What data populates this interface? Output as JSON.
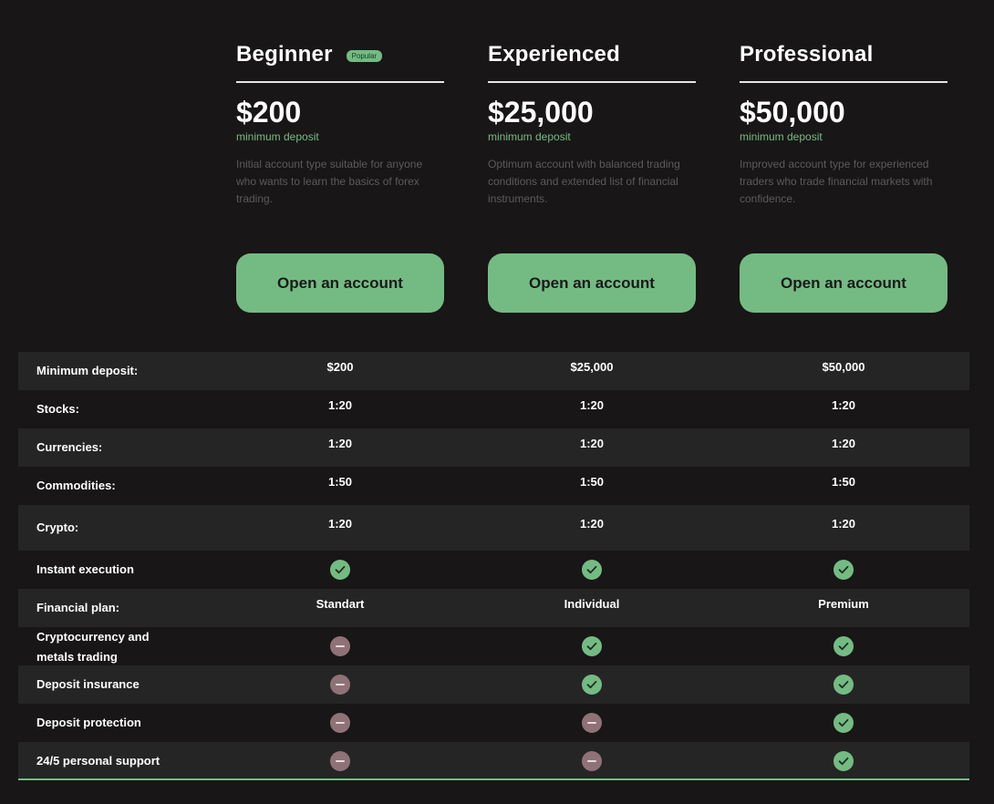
{
  "plans": [
    {
      "name": "Beginner",
      "badge": "Popular",
      "price": "$200",
      "price_sub": "minimum deposit",
      "description": "Initial account type suitable for anyone who wants to learn the basics of forex trading.",
      "button": "Open an account"
    },
    {
      "name": "Experienced",
      "badge": "",
      "price": "$25,000",
      "price_sub": "minimum deposit",
      "description": "Optimum account with balanced trading conditions and extended list of financial instruments.",
      "button": "Open an account"
    },
    {
      "name": "Professional",
      "badge": "",
      "price": "$50,000",
      "price_sub": "minimum deposit",
      "description": "Improved account type for experienced traders who trade financial markets with confidence.",
      "button": "Open an account"
    }
  ],
  "table": {
    "rows": [
      {
        "label": "Minimum deposit:",
        "values": [
          "$200",
          "$25,000",
          "$50,000"
        ]
      },
      {
        "label": "Stocks:",
        "values": [
          "1:20",
          "1:20",
          "1:20"
        ]
      },
      {
        "label": "Currencies:",
        "values": [
          "1:20",
          "1:20",
          "1:20"
        ]
      },
      {
        "label": "Commodities:",
        "values": [
          "1:50",
          "1:50",
          "1:50"
        ]
      },
      {
        "label": "Crypto:",
        "values": [
          "1:20",
          "1:20",
          "1:20"
        ]
      },
      {
        "label": "Instant execution",
        "values": [
          "check-icon",
          "check-icon",
          "check-icon"
        ]
      },
      {
        "label": "Financial plan:",
        "values": [
          "Standart",
          "Individual",
          "Premium"
        ]
      },
      {
        "label": "Cryptocurrency and metals trading",
        "values": [
          "minus-icon",
          "check-icon",
          "check-icon"
        ]
      },
      {
        "label": "Deposit insurance",
        "values": [
          "minus-icon",
          "check-icon",
          "check-icon"
        ]
      },
      {
        "label": "Deposit protection",
        "values": [
          "minus-icon",
          "minus-icon",
          "check-icon"
        ]
      },
      {
        "label": "24/5 personal support",
        "values": [
          "minus-icon",
          "minus-icon",
          "check-icon"
        ]
      }
    ]
  },
  "colors": {
    "background": "#181617",
    "accent": "#74bb83",
    "row_alt": "#252526",
    "unavailable": "#8e7278"
  }
}
